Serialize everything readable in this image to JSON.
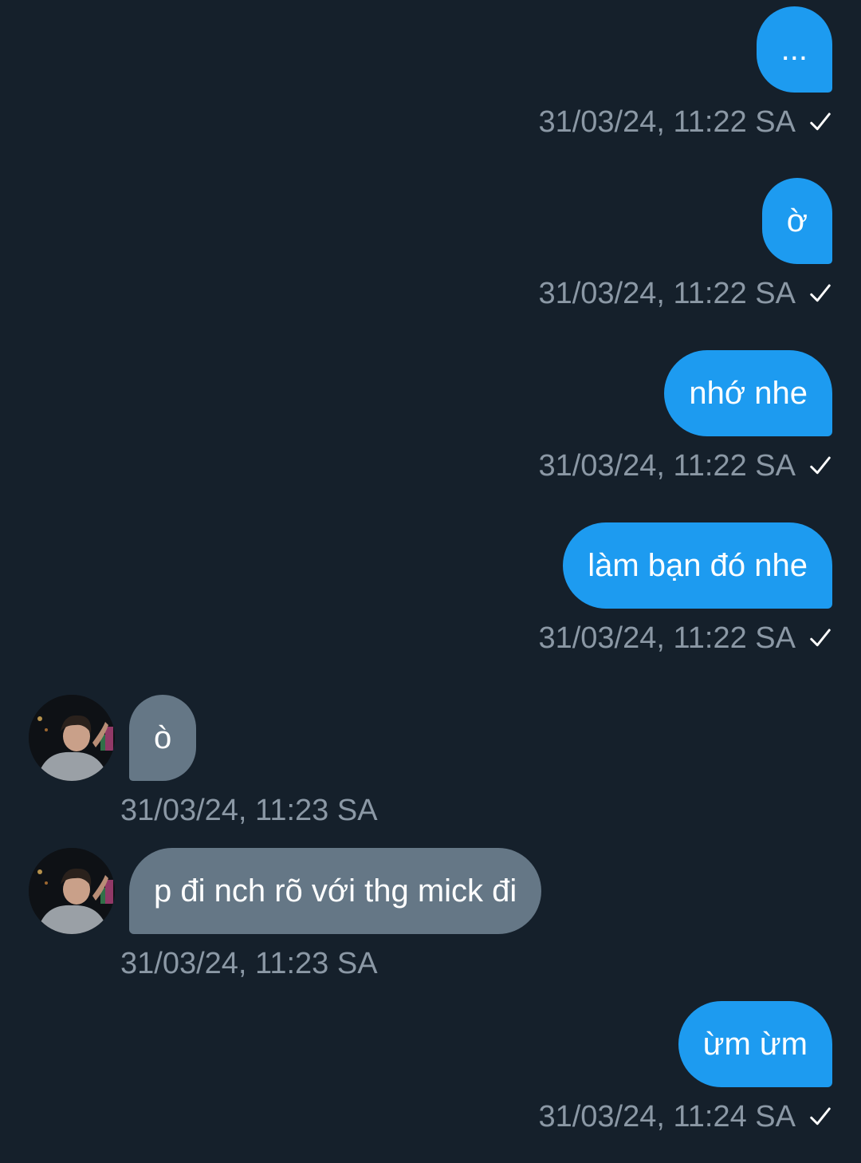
{
  "conversation": {
    "messages": [
      {
        "direction": "out",
        "text": "...",
        "timestamp": "31/03/24, 11:22 SA",
        "status_icon": "sent-check-icon"
      },
      {
        "direction": "out",
        "text": "ờ",
        "timestamp": "31/03/24, 11:22 SA",
        "status_icon": "sent-check-icon"
      },
      {
        "direction": "out",
        "text": "nhớ nhe",
        "timestamp": "31/03/24, 11:22 SA",
        "status_icon": "sent-check-icon"
      },
      {
        "direction": "out",
        "text": "làm bạn đó nhe",
        "timestamp": "31/03/24, 11:22 SA",
        "status_icon": "sent-check-icon"
      },
      {
        "direction": "in",
        "text": "ò",
        "timestamp": "31/03/24, 11:23 SA",
        "avatar_icon": "user-avatar"
      },
      {
        "direction": "in",
        "text": "p đi nch rõ với thg mick đi",
        "timestamp": "31/03/24, 11:23 SA",
        "avatar_icon": "user-avatar"
      },
      {
        "direction": "out",
        "text": "ừm ừm",
        "timestamp": "31/03/24, 11:24 SA",
        "status_icon": "sent-check-icon"
      }
    ]
  },
  "colors": {
    "background": "#15202b",
    "outgoing_bubble": "#1d9bf0",
    "incoming_bubble": "#657786",
    "timestamp_text": "#8b98a5",
    "message_text": "#ffffff"
  }
}
